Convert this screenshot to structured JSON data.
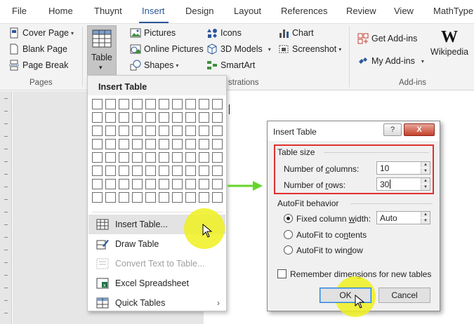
{
  "menu_tabs": [
    "File",
    "Home",
    "Thuynt",
    "Insert",
    "Design",
    "Layout",
    "References",
    "Review",
    "View",
    "MathType"
  ],
  "active_tab": "Insert",
  "ribbon": {
    "pages": {
      "cover_page": "Cover Page",
      "blank_page": "Blank Page",
      "page_break": "Page Break",
      "group_label": "Pages"
    },
    "table": {
      "label": "Table"
    },
    "illustrations": {
      "pictures": "Pictures",
      "online_pictures": "Online Pictures",
      "shapes": "Shapes",
      "icons": "Icons",
      "models_3d": "3D Models",
      "smartart": "SmartArt",
      "chart": "Chart",
      "screenshot": "Screenshot",
      "group_label_partial": "strations"
    },
    "addins": {
      "get_addins": "Get Add-ins",
      "my_addins": "My Add-ins",
      "wikipedia": "Wikipedia",
      "group_label": "Add-ins"
    }
  },
  "dropdown": {
    "title": "Insert Table",
    "grid": {
      "columns": 10,
      "rows": 8
    },
    "items": [
      {
        "label": "Insert Table...",
        "icon": "table-grid-icon",
        "hover": true
      },
      {
        "label": "Draw Table",
        "icon": "draw-table-icon"
      },
      {
        "label": "Convert Text to Table...",
        "icon": "convert-table-icon",
        "disabled": true
      },
      {
        "label": "Excel Spreadsheet",
        "icon": "excel-icon"
      },
      {
        "label": "Quick Tables",
        "icon": "quick-tables-icon",
        "submenu": true
      }
    ]
  },
  "dialog": {
    "title": "Insert Table",
    "help_button": "?",
    "close_button": "X",
    "table_size_label": "Table size",
    "columns_label": "Number of columns:",
    "columns_value": "10",
    "rows_label": "Number of rows:",
    "rows_value": "30",
    "autofit_label": "AutoFit behavior",
    "fixed_width_label": "Fixed column width:",
    "fixed_width_value": "Auto",
    "autofit_contents_label": "AutoFit to contents",
    "autofit_window_label": "AutoFit to window",
    "selected_behavior": "fixed",
    "remember_label": "Remember dimensions for new tables",
    "remember_checked": false,
    "ok_label": "OK",
    "cancel_label": "Cancel"
  },
  "colors": {
    "accent": "#2b579a",
    "highlight": "#f0f01e",
    "arrow": "#66d42a",
    "outline": "#e03030"
  }
}
